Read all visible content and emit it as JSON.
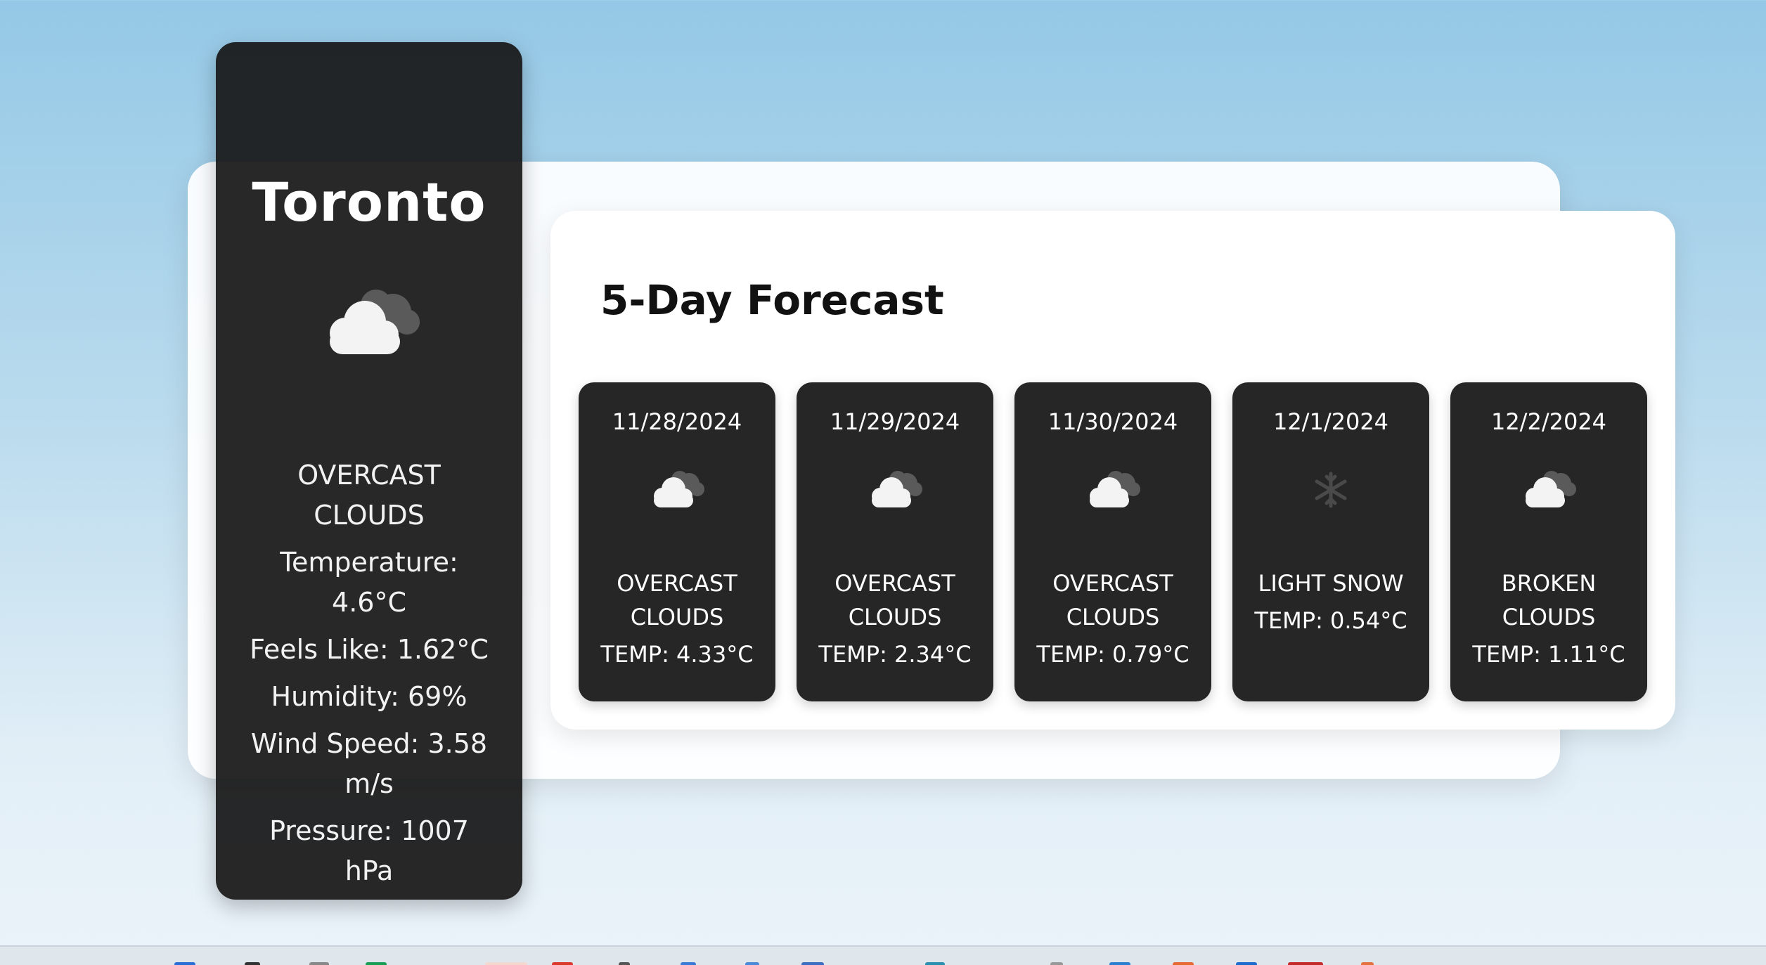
{
  "current": {
    "city": "Toronto",
    "icon": "cloud-icon",
    "description": "OVERCAST CLOUDS",
    "temperature": "Temperature: 4.6°C",
    "feels_like": "Feels Like: 1.62°C",
    "humidity": "Humidity: 69%",
    "wind_speed": "Wind Speed: 3.58 m/s",
    "pressure": "Pressure: 1007 hPa"
  },
  "forecast": {
    "title": "5-Day Forecast",
    "days": [
      {
        "date": "11/28/2024",
        "icon": "cloud-icon",
        "description": "OVERCAST CLOUDS",
        "temp": "Temp: 4.33°C"
      },
      {
        "date": "11/29/2024",
        "icon": "cloud-icon",
        "description": "OVERCAST CLOUDS",
        "temp": "Temp: 2.34°C"
      },
      {
        "date": "11/30/2024",
        "icon": "cloud-icon",
        "description": "OVERCAST CLOUDS",
        "temp": "Temp: 0.79°C"
      },
      {
        "date": "12/1/2024",
        "icon": "snowflake-icon",
        "description": "LIGHT SNOW",
        "temp": "Temp: 0.54°C"
      },
      {
        "date": "12/2/2024",
        "icon": "cloud-icon",
        "description": "BROKEN CLOUDS",
        "temp": "Temp: 1.11°C"
      }
    ]
  },
  "colors": {
    "card_background": "#262626",
    "panel_background": "#ffffff",
    "sky_top": "#94c8e6",
    "sky_bottom": "#eaf3f9"
  },
  "taskbar": {
    "icons": [
      "windows-icon",
      "search-icon",
      "file-explorer-icon",
      "edge-icon",
      "app-icon",
      "chrome-icon",
      "app-icon",
      "app-icon",
      "mail-icon",
      "terminal-icon",
      "app-icon",
      "app-icon",
      "vscode-icon",
      "app-icon",
      "app-icon",
      "app-icon",
      "app-icon"
    ]
  }
}
